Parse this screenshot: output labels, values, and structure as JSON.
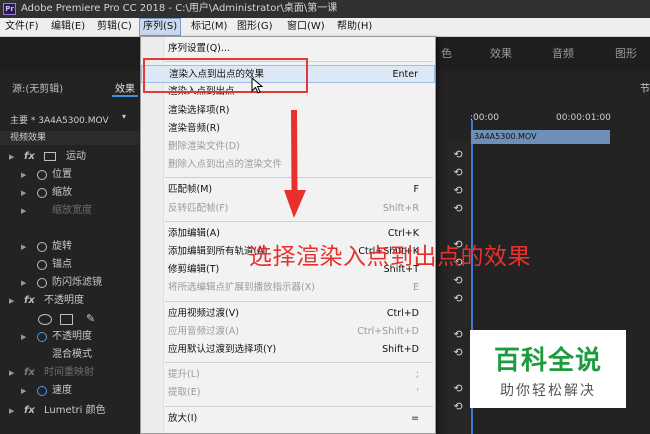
{
  "window": {
    "title": "Adobe Premiere Pro CC 2018 - C:\\用户\\Administrator\\桌面\\第一课",
    "icon": "Pr"
  },
  "menubar": [
    "文件(F)",
    "编辑(E)",
    "剪辑(C)",
    "序列(S)",
    "标记(M)",
    "图形(G)",
    "窗口(W)",
    "帮助(H)"
  ],
  "workspace_tabs": [
    "色",
    "效果",
    "音频",
    "图形"
  ],
  "left_panel": {
    "source_tab": "源:(无剪辑)",
    "effects_tab": "效果",
    "master": "主要 * 3A4A5300.MOV",
    "video_effects": "视频效果",
    "rows": [
      {
        "fx": "fx",
        "label": "运动"
      },
      {
        "label": "位置"
      },
      {
        "label": "缩放"
      },
      {
        "label": "缩放宽度"
      },
      {
        "label": "旋转"
      },
      {
        "label": "锚点"
      },
      {
        "label": "防闪烁滤镜"
      },
      {
        "fx": "fx",
        "label": "不透明度"
      },
      {
        "label": "不透明度"
      },
      {
        "label": "混合模式"
      },
      {
        "fx": "fx",
        "label": "时间重映射"
      },
      {
        "label": "速度"
      },
      {
        "fx": "fx",
        "label": "Lumetri 颜色"
      }
    ]
  },
  "timeline": {
    "timecode_left": ":00:00",
    "timecode_right": "00:00:01:00",
    "clip": "3A4A5300.MOV",
    "edge_label": "节"
  },
  "sequence_menu": {
    "items": [
      {
        "label": "序列设置(Q)...",
        "shortcut": "",
        "enabled": true
      },
      {
        "sep": true
      },
      {
        "label": "渲染入点到出点的效果",
        "shortcut": "Enter",
        "enabled": true,
        "highlight": true
      },
      {
        "label": "渲染入点到出点",
        "shortcut": "",
        "enabled": true
      },
      {
        "label": "渲染选择项(R)",
        "shortcut": "",
        "enabled": true
      },
      {
        "label": "渲染音频(R)",
        "shortcut": "",
        "enabled": true
      },
      {
        "label": "删除渲染文件(D)",
        "shortcut": "",
        "enabled": false
      },
      {
        "label": "删除入点到出点的渲染文件",
        "shortcut": "",
        "enabled": false
      },
      {
        "sep": true
      },
      {
        "label": "匹配帧(M)",
        "shortcut": "F",
        "enabled": true
      },
      {
        "label": "反转匹配帧(F)",
        "shortcut": "Shift+R",
        "enabled": false
      },
      {
        "sep": true
      },
      {
        "label": "添加编辑(A)",
        "shortcut": "Ctrl+K",
        "enabled": true
      },
      {
        "label": "添加编辑到所有轨道(A)",
        "shortcut": "Ctrl+Shift+K",
        "enabled": true
      },
      {
        "label": "修剪编辑(T)",
        "shortcut": "Shift+T",
        "enabled": true
      },
      {
        "label": "将所选编辑点扩展到播放指示器(X)",
        "shortcut": "E",
        "enabled": false
      },
      {
        "sep": true
      },
      {
        "label": "应用视频过渡(V)",
        "shortcut": "Ctrl+D",
        "enabled": true
      },
      {
        "label": "应用音频过渡(A)",
        "shortcut": "Ctrl+Shift+D",
        "enabled": false
      },
      {
        "label": "应用默认过渡到选择项(Y)",
        "shortcut": "Shift+D",
        "enabled": true
      },
      {
        "sep": true
      },
      {
        "label": "提升(L)",
        "shortcut": ";",
        "enabled": false
      },
      {
        "label": "提取(E)",
        "shortcut": "'",
        "enabled": false
      },
      {
        "sep": true
      },
      {
        "label": "放大(I)",
        "shortcut": "=",
        "enabled": true
      }
    ]
  },
  "annotation": {
    "text": "选择渲染入点到出点的效果",
    "color": "#e8312f"
  },
  "watermark": {
    "main": "百科全说",
    "sub": "助你轻松解决",
    "color": "#1e9b3e"
  }
}
